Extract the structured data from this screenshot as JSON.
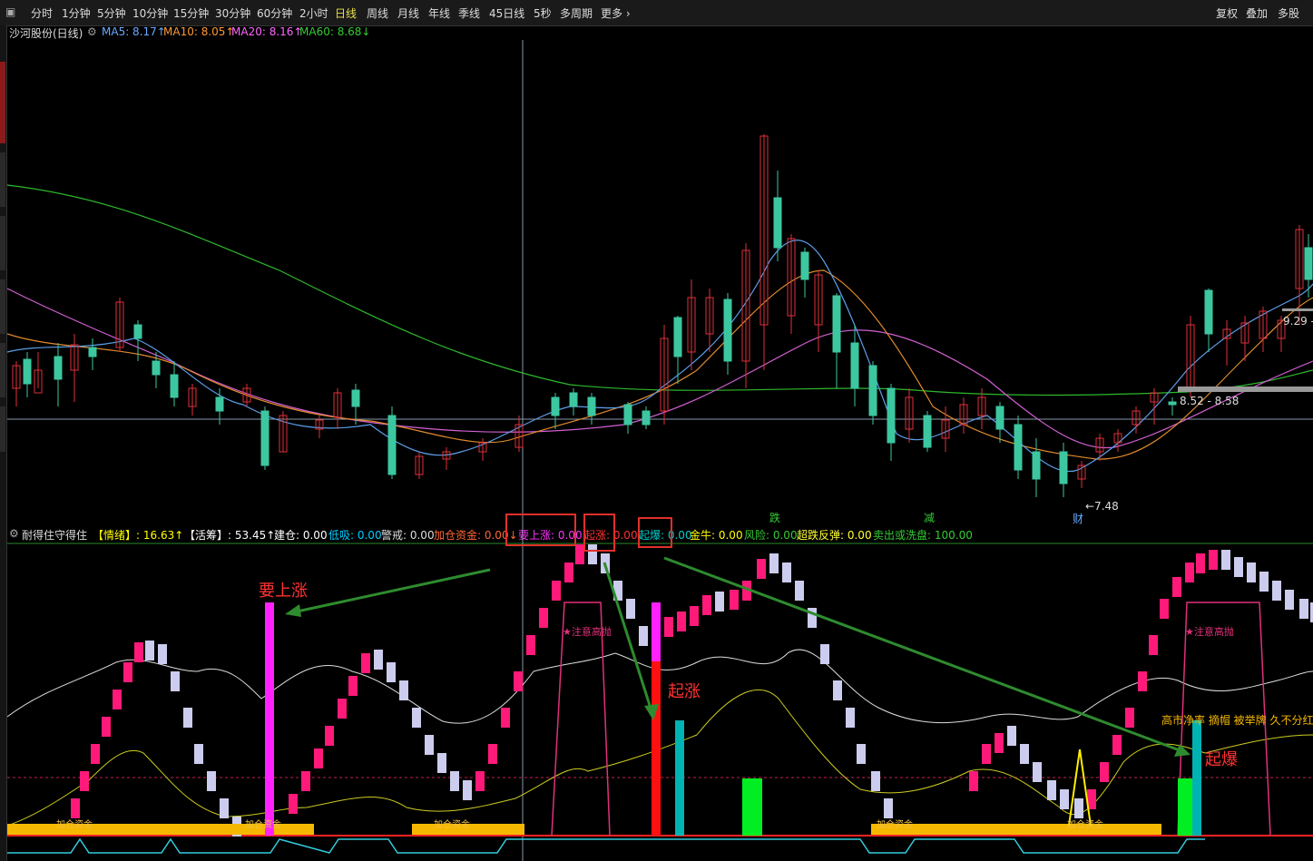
{
  "toolbar": {
    "periods": [
      "分时",
      "1分钟",
      "5分钟",
      "10分钟",
      "15分钟",
      "30分钟",
      "60分钟",
      "2小时",
      "日线",
      "周线",
      "月线",
      "年线",
      "季线",
      "45日线",
      "5秒",
      "多周期",
      "更多"
    ],
    "active": "日线",
    "right": [
      "复权",
      "叠加",
      "多股"
    ]
  },
  "main": {
    "stock": "沙河股份(日线)",
    "ma": [
      {
        "label": "MA5: 8.17",
        "arrow": "↑",
        "color": "#6aa9ff"
      },
      {
        "label": "MA10: 8.05",
        "arrow": "↑",
        "color": "#ff9933"
      },
      {
        "label": "MA20: 8.16",
        "arrow": "↑",
        "color": "#ff66ff"
      },
      {
        "label": "MA60: 8.68",
        "arrow": "↓",
        "color": "#33cc33"
      }
    ],
    "annot_low": "←7.48",
    "annot_high": "9.29 -",
    "annot_range": "8.52 - 8.58",
    "marks": [
      "跌",
      "减",
      "财"
    ]
  },
  "indicator": {
    "name": "耐得住守得住",
    "items": [
      {
        "label": "【情绪】: 16.63",
        "arrow": "↑",
        "color": "#ffff00"
      },
      {
        "label": "【活筹】: 53.45",
        "arrow": "↑",
        "color": "#ffffff"
      },
      {
        "label": "建仓: 0.00",
        "color": "#ffffff"
      },
      {
        "label": "低吸: 0.00",
        "color": "#00ccff"
      },
      {
        "label": "警戒: 0.00",
        "color": "#dddddd"
      },
      {
        "label": "加仓资金: 0.00",
        "arrow": "↓",
        "color": "#ff6633"
      },
      {
        "label": "要上涨: 0.00",
        "color": "#ff33ff"
      },
      {
        "label": "起涨: 0.00",
        "color": "#ff3333"
      },
      {
        "label": "起爆: 0.00",
        "color": "#00cccc"
      },
      {
        "label": "金牛: 0.00",
        "color": "#ffff00"
      },
      {
        "label": "风险: 0.00",
        "color": "#33cc33"
      },
      {
        "label": "超跌反弹: 0.00",
        "color": "#ffff33"
      },
      {
        "label": "卖出或洗盘: 100.00",
        "color": "#33cc33"
      }
    ],
    "callouts": {
      "up": "要上涨",
      "rise": "起涨",
      "burst": "起爆"
    },
    "notes": [
      "★注意高抛",
      "★注意高抛"
    ],
    "bar_labels": [
      "加仓资金",
      "加仓资金",
      "加仓资金",
      "加仓资金",
      "加仓资金"
    ],
    "news": "高市净率 摘帽 被举牌 久不分红"
  }
}
